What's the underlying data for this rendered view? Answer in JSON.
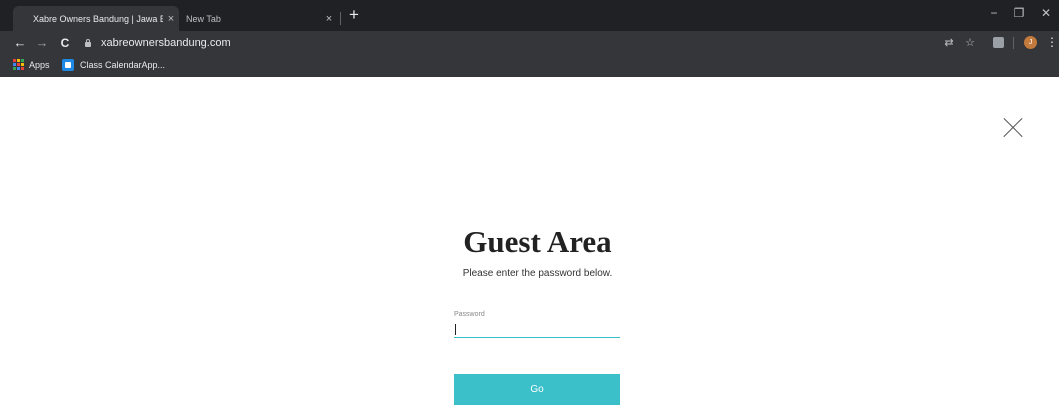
{
  "browser": {
    "tabs": [
      {
        "title": "Xabre Owners Bandung | Jawa Ba",
        "active": true
      },
      {
        "title": "New Tab",
        "active": false
      }
    ],
    "tab_close_glyph": "×",
    "new_tab_glyph": "+",
    "window_controls": {
      "minimize": "−",
      "maximize": "❐",
      "close": "✕"
    },
    "nav": {
      "back": "←",
      "forward": "→",
      "reload": "C"
    },
    "url": "xabreownersbandung.com",
    "toolbar_icons": {
      "translate": "⇄",
      "bookmark_star": "☆",
      "menu": "⋮"
    },
    "profile_initial": "J",
    "bookmarks": [
      {
        "label": "Apps",
        "icon": "apps-grid-icon"
      },
      {
        "label": "Class CalendarApp...",
        "icon": "calendar-app-icon"
      }
    ],
    "apps_grid_colors": [
      "#ea4335",
      "#fbbc04",
      "#34a853",
      "#4285f4",
      "#ea4335",
      "#fbbc04",
      "#34a853",
      "#4285f4",
      "#ea4335"
    ]
  },
  "page": {
    "title": "Guest Area",
    "subtitle": "Please enter the password below.",
    "password_label": "Password",
    "password_value": "",
    "submit_label": "Go",
    "accent_color": "#3bbfc8",
    "close_icon": "close-icon"
  }
}
